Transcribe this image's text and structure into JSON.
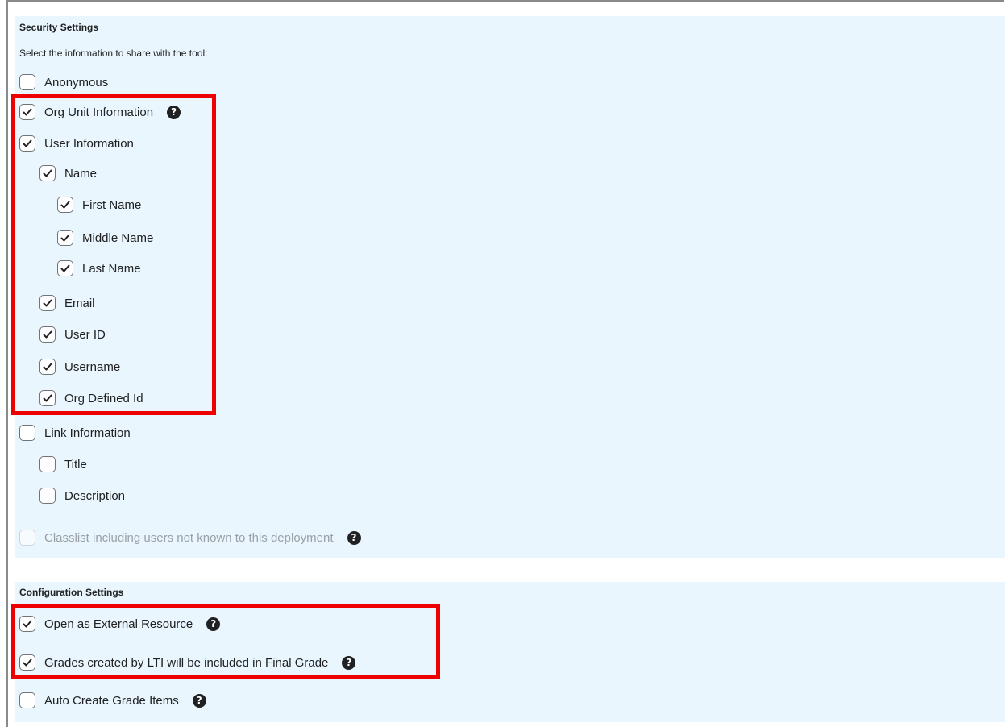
{
  "security": {
    "heading": "Security Settings",
    "instruction": "Select the information to share with the tool:",
    "options": [
      {
        "label": "Anonymous",
        "checked": false
      },
      {
        "label": "Org Unit Information",
        "checked": true,
        "help": "?"
      },
      {
        "label": "User Information",
        "checked": true
      },
      {
        "label": "Name",
        "checked": true
      },
      {
        "label": "First Name",
        "checked": true
      },
      {
        "label": "Middle Name",
        "checked": true
      },
      {
        "label": "Last Name",
        "checked": true
      },
      {
        "label": "Email",
        "checked": true
      },
      {
        "label": "User ID",
        "checked": true
      },
      {
        "label": "Username",
        "checked": true
      },
      {
        "label": "Org Defined Id",
        "checked": true
      },
      {
        "label": "Link Information",
        "checked": false
      },
      {
        "label": "Title",
        "checked": false
      },
      {
        "label": "Description",
        "checked": false
      },
      {
        "label": "Classlist including users not known to this deployment",
        "checked": false,
        "disabled": true,
        "help": "?"
      }
    ]
  },
  "configuration": {
    "heading": "Configuration Settings",
    "options": [
      {
        "label": "Open as External Resource",
        "checked": true,
        "help": "?"
      },
      {
        "label": "Grades created by LTI will be included in Final Grade",
        "checked": true,
        "help": "?"
      },
      {
        "label": "Auto Create Grade Items",
        "checked": false,
        "help": "?"
      }
    ]
  },
  "colors": {
    "panel_background": "#e9f6fd",
    "highlight_border": "#ee0000",
    "checkbox_border": "#6e7477",
    "help_icon": "#202122"
  }
}
